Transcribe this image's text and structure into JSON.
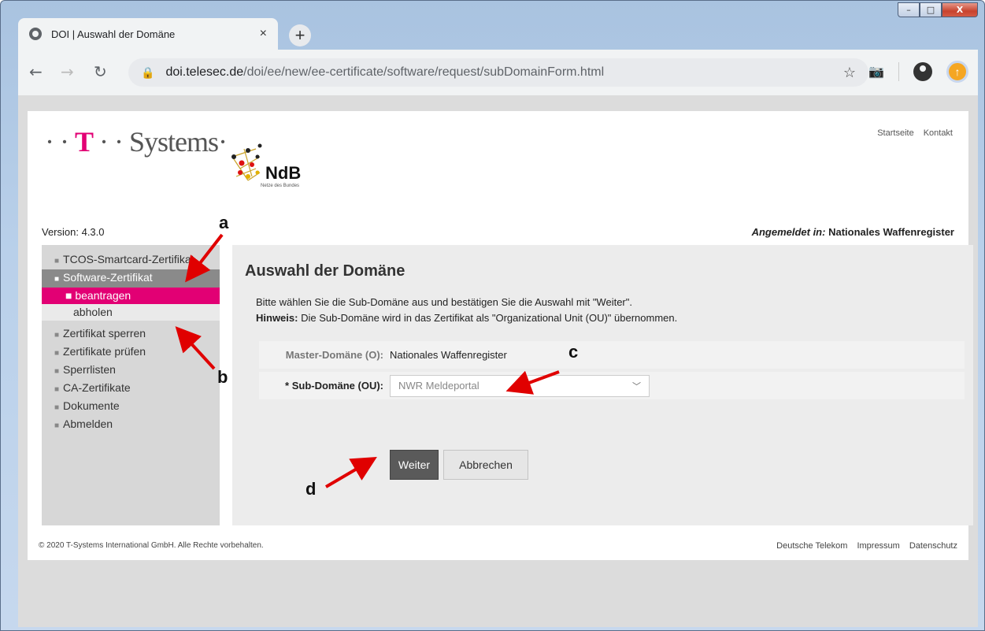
{
  "browser": {
    "tab_title": "DOI | Auswahl der Domäne",
    "tab_close": "×",
    "new_tab": "+",
    "url_host": "doi.telesec.de",
    "url_path": "/doi/ee/new/ee-certificate/software/request/subDomainForm.html",
    "window_controls": {
      "minimize": "–",
      "maximize": "□",
      "close": "X"
    }
  },
  "header": {
    "logo_text_pre": "· · ",
    "logo_t": "T",
    "logo_text_post": " · · Systems·",
    "ndb_title": "NdB",
    "ndb_subtitle": "Netze des Bundes",
    "links": [
      "Startseite",
      "Kontakt"
    ]
  },
  "version": "Version: 4.3.0",
  "logged_in_label": "Angemeldet in:",
  "logged_in_value": "Nationales Waffenregister",
  "sidebar": {
    "items": [
      {
        "label": "TCOS-Smartcard-Zertifikat"
      },
      {
        "label": "Software-Zertifikat"
      },
      {
        "label": "beantragen"
      },
      {
        "label": "abholen"
      },
      {
        "label": "Zertifikat sperren"
      },
      {
        "label": "Zertifikate prüfen"
      },
      {
        "label": "Sperrlisten"
      },
      {
        "label": "CA-Zertifikate"
      },
      {
        "label": "Dokumente"
      },
      {
        "label": "Abmelden"
      }
    ]
  },
  "main": {
    "title": "Auswahl der Domäne",
    "intro_line1": "Bitte wählen Sie die Sub-Domäne aus und bestätigen Sie die Auswahl mit \"Weiter\".",
    "hint_label": "Hinweis:",
    "hint_text": " Die Sub-Domäne wird in das Zertifikat als \"Organizational Unit (OU)\" übernommen.",
    "master_label": "Master-Domäne (O):",
    "master_value": "Nationales Waffenregister",
    "sub_label": "* Sub-Domäne (OU):",
    "sub_value": "NWR Meldeportal",
    "weiter": "Weiter",
    "abbrechen": "Abbrechen"
  },
  "footer": {
    "copyright": "© 2020 T-Systems International GmbH. Alle Rechte vorbehalten.",
    "links": [
      "Deutsche Telekom",
      "Impressum",
      "Datenschutz"
    ]
  },
  "annotations": {
    "a": "a",
    "b": "b",
    "c": "c",
    "d": "d"
  },
  "colors": {
    "magenta": "#e20074",
    "annotation_arrow": "#e00000"
  }
}
